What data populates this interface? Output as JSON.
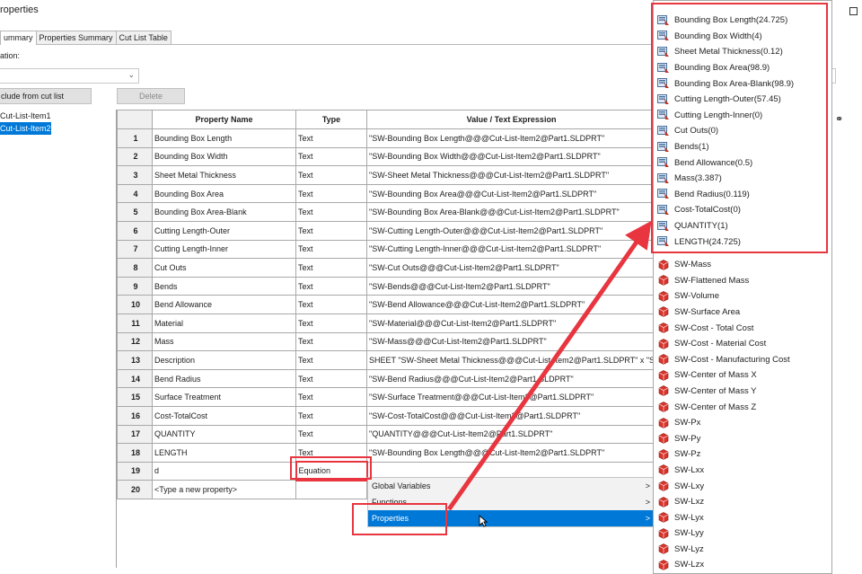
{
  "window": {
    "title": "roperties"
  },
  "tabs": [
    {
      "label": "ummary",
      "active": true
    },
    {
      "label": "Properties Summary",
      "active": false
    },
    {
      "label": "Cut List Table",
      "active": false
    }
  ],
  "location": {
    "label": "ation:",
    "value": ""
  },
  "buttons": {
    "exclude": "clude from cut list",
    "delete": "Delete"
  },
  "cut_list": [
    "Cut-List-Item1",
    "Cut-List-Item2"
  ],
  "grid": {
    "headers": [
      "Property Name",
      "Type",
      "Value / Text Expression"
    ],
    "rows": [
      {
        "num": "1",
        "name": "Bounding Box Length",
        "type": "Text",
        "value": "\"SW-Bounding Box Length@@@Cut-List-Item2@Part1.SLDPRT\""
      },
      {
        "num": "2",
        "name": "Bounding Box Width",
        "type": "Text",
        "value": "\"SW-Bounding Box Width@@@Cut-List-Item2@Part1.SLDPRT\""
      },
      {
        "num": "3",
        "name": "Sheet Metal Thickness",
        "type": "Text",
        "value": "\"SW-Sheet Metal Thickness@@@Cut-List-Item2@Part1.SLDPRT\""
      },
      {
        "num": "4",
        "name": "Bounding Box Area",
        "type": "Text",
        "value": "\"SW-Bounding Box Area@@@Cut-List-Item2@Part1.SLDPRT\""
      },
      {
        "num": "5",
        "name": "Bounding Box Area-Blank",
        "type": "Text",
        "value": "\"SW-Bounding Box Area-Blank@@@Cut-List-Item2@Part1.SLDPRT\""
      },
      {
        "num": "6",
        "name": "Cutting Length-Outer",
        "type": "Text",
        "value": "\"SW-Cutting Length-Outer@@@Cut-List-Item2@Part1.SLDPRT\""
      },
      {
        "num": "7",
        "name": "Cutting Length-Inner",
        "type": "Text",
        "value": "\"SW-Cutting Length-Inner@@@Cut-List-Item2@Part1.SLDPRT\""
      },
      {
        "num": "8",
        "name": "Cut Outs",
        "type": "Text",
        "value": "\"SW-Cut Outs@@@Cut-List-Item2@Part1.SLDPRT\""
      },
      {
        "num": "9",
        "name": "Bends",
        "type": "Text",
        "value": "\"SW-Bends@@@Cut-List-Item2@Part1.SLDPRT\""
      },
      {
        "num": "10",
        "name": "Bend Allowance",
        "type": "Text",
        "value": "\"SW-Bend Allowance@@@Cut-List-Item2@Part1.SLDPRT\""
      },
      {
        "num": "11",
        "name": "Material",
        "type": "Text",
        "value": "\"SW-Material@@@Cut-List-Item2@Part1.SLDPRT\""
      },
      {
        "num": "12",
        "name": "Mass",
        "type": "Text",
        "value": "\"SW-Mass@@@Cut-List-Item2@Part1.SLDPRT\""
      },
      {
        "num": "13",
        "name": "Description",
        "type": "Text",
        "value": "SHEET \"SW-Sheet Metal Thickness@@@Cut-List-Item2@Part1.SLDPRT\" x \"S"
      },
      {
        "num": "14",
        "name": "Bend Radius",
        "type": "Text",
        "value": "\"SW-Bend Radius@@@Cut-List-Item2@Part1.SLDPRT\""
      },
      {
        "num": "15",
        "name": "Surface Treatment",
        "type": "Text",
        "value": "\"SW-Surface Treatment@@@Cut-List-Item2@Part1.SLDPRT\""
      },
      {
        "num": "16",
        "name": "Cost-TotalCost",
        "type": "Text",
        "value": "\"SW-Cost-TotalCost@@@Cut-List-Item2@Part1.SLDPRT\""
      },
      {
        "num": "17",
        "name": "QUANTITY",
        "type": "Text",
        "value": "\"QUANTITY@@@Cut-List-Item2@Part1.SLDPRT\""
      },
      {
        "num": "18",
        "name": "LENGTH",
        "type": "Text",
        "value": "\"SW-Bounding Box Length@@@Cut-List-Item2@Part1.SLDPRT\""
      },
      {
        "num": "19",
        "name": "d",
        "type": "Equation",
        "value": ""
      },
      {
        "num": "20",
        "name": "<Type a new property>",
        "type": "",
        "value": ""
      }
    ]
  },
  "context_menu": [
    {
      "label": "Global Variables",
      "highlighted": false
    },
    {
      "label": "Functions",
      "highlighted": false
    },
    {
      "label": "Properties",
      "highlighted": true
    }
  ],
  "property_list": {
    "cutlist_items": [
      "Bounding Box Length(24.725)",
      "Bounding Box Width(4)",
      "Sheet Metal Thickness(0.12)",
      "Bounding Box Area(98.9)",
      "Bounding Box Area-Blank(98.9)",
      "Cutting Length-Outer(57.45)",
      "Cutting Length-Inner(0)",
      "Cut Outs(0)",
      "Bends(1)",
      "Bend Allowance(0.5)",
      "Mass(3.387)",
      "Bend Radius(0.119)",
      "Cost-TotalCost(0)",
      "QUANTITY(1)",
      "LENGTH(24.725)"
    ],
    "sw_items": [
      "SW-Mass",
      "SW-Flattened Mass",
      "SW-Volume",
      "SW-Surface Area",
      "SW-Cost - Total Cost",
      "SW-Cost - Material Cost",
      "SW-Cost - Manufacturing Cost",
      "SW-Center of Mass X",
      "SW-Center of Mass Y",
      "SW-Center of Mass Z",
      "SW-Px",
      "SW-Py",
      "SW-Pz",
      "SW-Lxx",
      "SW-Lxy",
      "SW-Lxz",
      "SW-Lyx",
      "SW-Lyy",
      "SW-Lyz",
      "SW-Lzx"
    ]
  },
  "colors": {
    "accent": "#0078d7",
    "callout": "#e8353f",
    "header_bg": "#f0f0f0"
  },
  "icons": {
    "cutlist_item": "cutlist-property-icon",
    "sw_item": "part-property-icon"
  }
}
